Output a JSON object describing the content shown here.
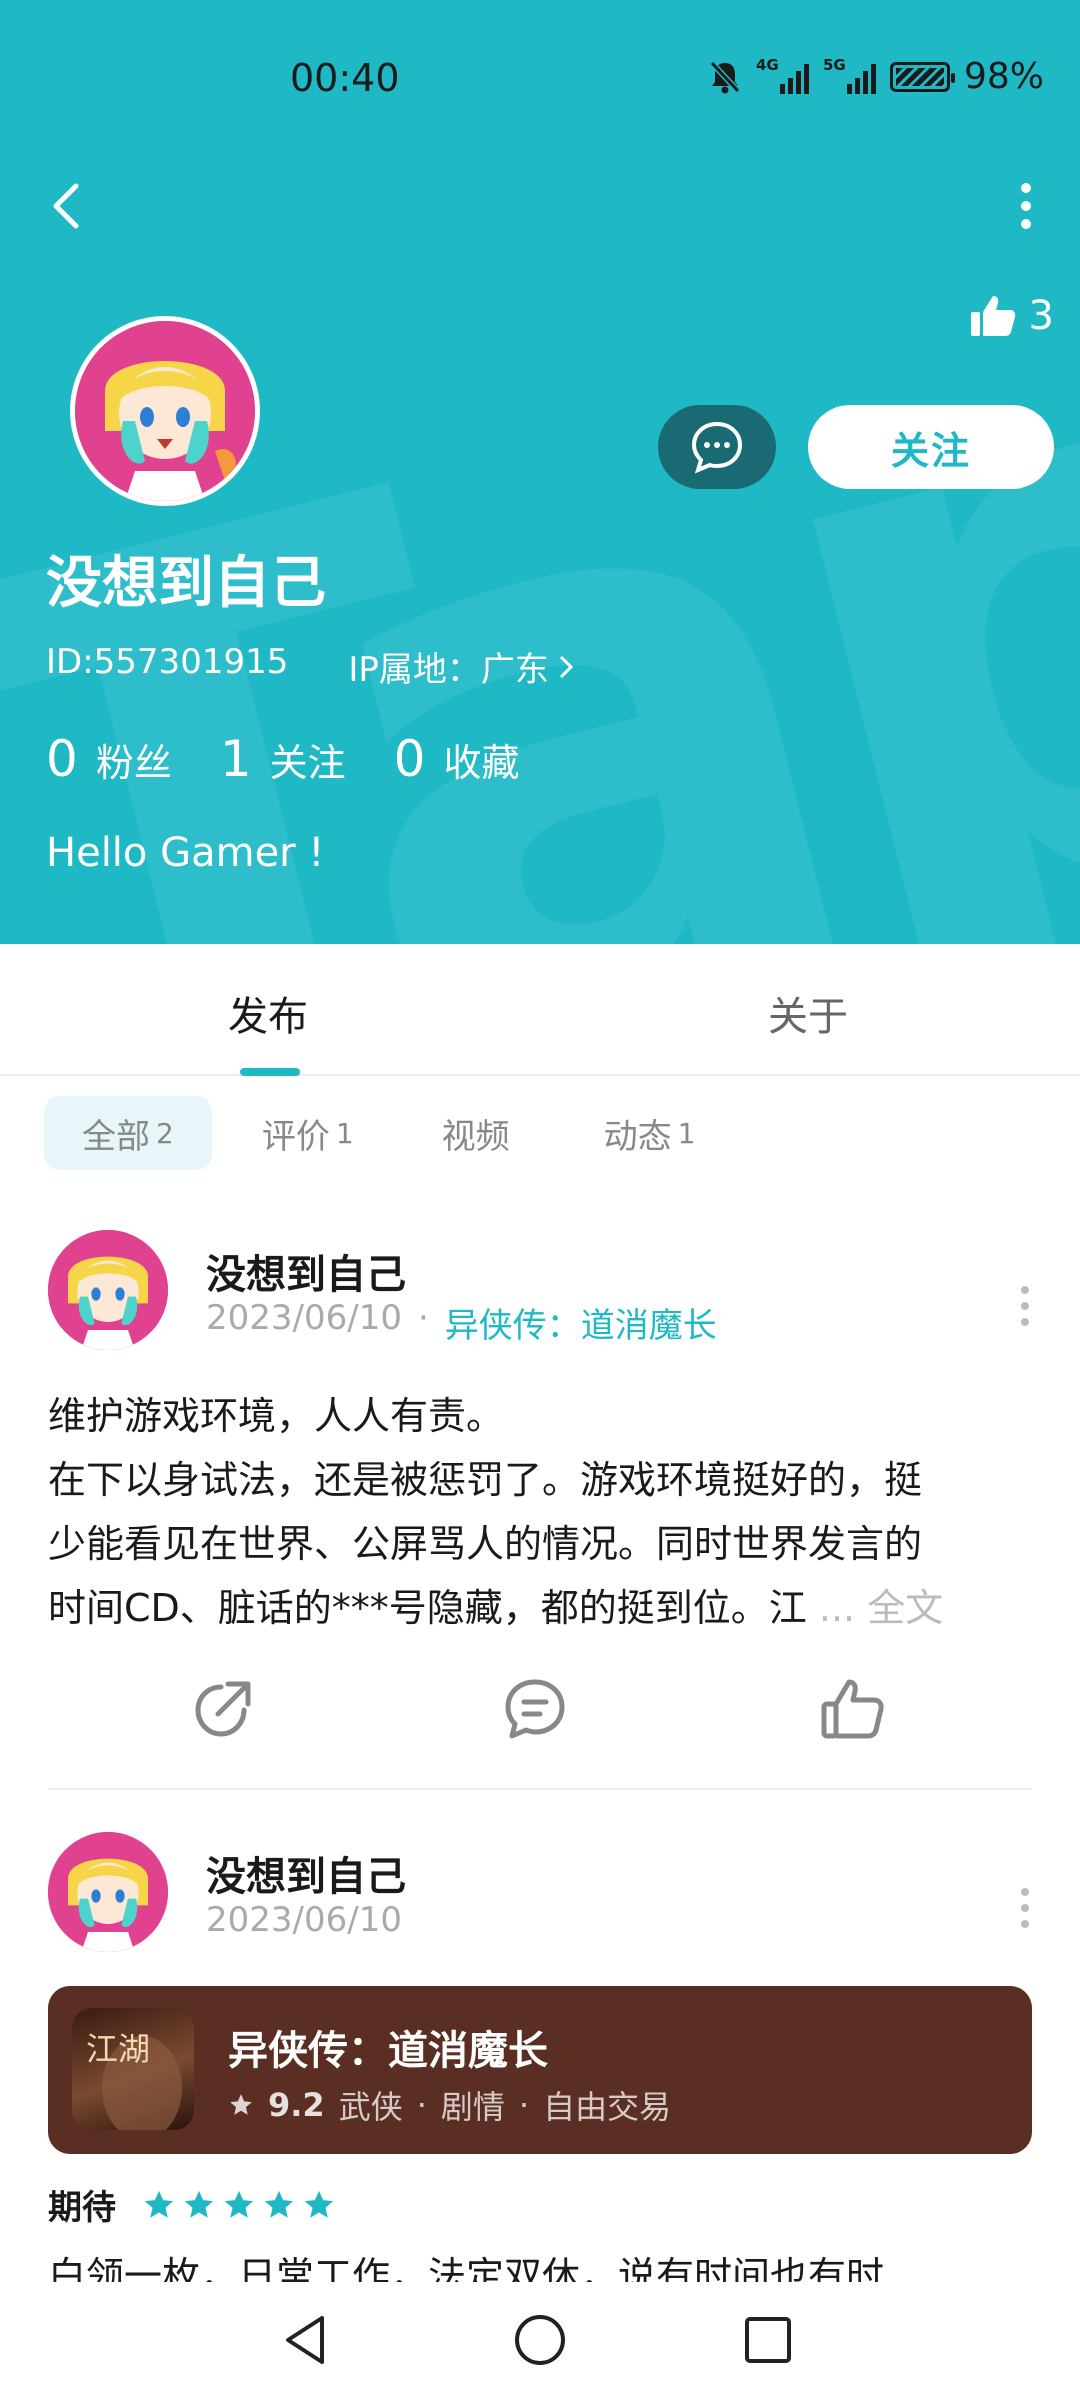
{
  "status_bar": {
    "time": "00:40",
    "battery": "98%",
    "signal1": "4G",
    "signal2": "5G"
  },
  "header": {
    "like_count": "3",
    "follow_label": "关注",
    "accent": "#1fb9c6"
  },
  "profile": {
    "username": "没想到自己",
    "id_text": "ID:557301915",
    "ip_text": "IP属地：广东",
    "stats": [
      {
        "value": "0",
        "label": "粉丝"
      },
      {
        "value": "1",
        "label": "关注"
      },
      {
        "value": "0",
        "label": "收藏"
      }
    ],
    "bio": "Hello Gamer !"
  },
  "tabs": [
    {
      "label": "发布"
    },
    {
      "label": "关于"
    }
  ],
  "filters": [
    {
      "label": "全部",
      "count": "2"
    },
    {
      "label": "评价",
      "count": "1"
    },
    {
      "label": "视频",
      "count": ""
    },
    {
      "label": "动态",
      "count": "1"
    }
  ],
  "posts": [
    {
      "author": "没想到自己",
      "date": "2023/06/10",
      "separator": "·",
      "game": "异侠传：道消魔长",
      "lines": [
        "维护游戏环境，人人有责。",
        "在下以身试法，还是被惩罚了。游戏环境挺好的，挺",
        "少能看见在世界、公屏骂人的情况。同时世界发言的",
        "时间CD、脏话的***号隐藏，都的挺到位。江"
      ],
      "ellipsis": "...",
      "full_text": "全文"
    },
    {
      "author": "没想到自己",
      "date": "2023/06/10",
      "game_card": {
        "title": "异侠传：道消魔长",
        "score": "9.2",
        "tags": [
          "武侠",
          "剧情",
          "自由交易"
        ],
        "icon_text": "江湖"
      },
      "review_label": "期待",
      "rating": 5,
      "preview": "白领一枚，日常工作，法定双休，说有时间也有时"
    }
  ]
}
